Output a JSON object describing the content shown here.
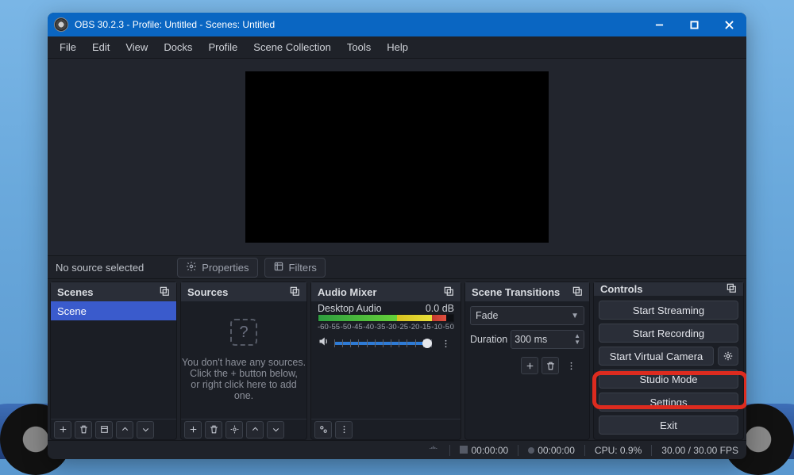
{
  "titlebar": {
    "title": "OBS 30.2.3 - Profile: Untitled - Scenes: Untitled"
  },
  "menu": {
    "items": [
      "File",
      "Edit",
      "View",
      "Docks",
      "Profile",
      "Scene Collection",
      "Tools",
      "Help"
    ]
  },
  "toolbar": {
    "no_source": "No source selected",
    "properties": "Properties",
    "filters": "Filters"
  },
  "docks": {
    "scenes": {
      "title": "Scenes",
      "items": [
        "Scene"
      ]
    },
    "sources": {
      "title": "Sources",
      "empty_l1": "You don't have any sources.",
      "empty_l2": "Click the + button below,",
      "empty_l3": "or right click here to add one."
    },
    "mixer": {
      "title": "Audio Mixer",
      "track_name": "Desktop Audio",
      "track_level": "0.0 dB",
      "scale": [
        "-60",
        "-55",
        "-50",
        "-45",
        "-40",
        "-35",
        "-30",
        "-25",
        "-20",
        "-15",
        "-10",
        "-5",
        "0"
      ]
    },
    "transitions": {
      "title": "Scene Transitions",
      "selected": "Fade",
      "duration_label": "Duration",
      "duration_value": "300 ms"
    },
    "controls": {
      "title": "Controls",
      "start_streaming": "Start Streaming",
      "start_recording": "Start Recording",
      "start_virtual_camera": "Start Virtual Camera",
      "studio_mode": "Studio Mode",
      "settings": "Settings",
      "exit": "Exit"
    }
  },
  "statusbar": {
    "time1": "00:00:00",
    "time2": "00:00:00",
    "cpu": "CPU: 0.9%",
    "fps": "30.00 / 30.00 FPS"
  }
}
